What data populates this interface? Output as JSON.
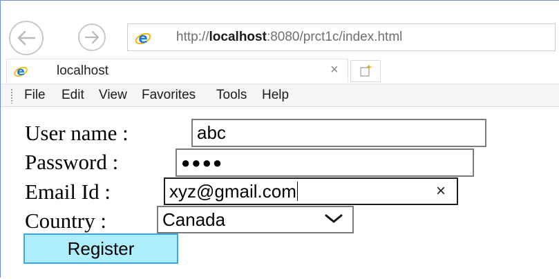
{
  "browser": {
    "url_prefix": "http://",
    "url_host": "localhost",
    "url_rest": ":8080/prct1c/index.html",
    "tab_title": "localhost",
    "tab_close": "×",
    "icons": {
      "back": "back-arrow-icon",
      "forward": "forward-arrow-icon",
      "page": "ie-logo-icon",
      "new_tab": "new-tab-icon"
    }
  },
  "menu": [
    "File",
    "Edit",
    "View",
    "Favorites",
    "Tools",
    "Help"
  ],
  "form": {
    "username_label": "User name :",
    "username_value": "abc",
    "password_label": "Password :",
    "password_mask": "●●●●",
    "email_label": "Email Id :",
    "email_value": "xyz@gmail.com",
    "email_clear": "×",
    "country_label": "Country :",
    "country_value": "Canada",
    "register_label": "Register"
  },
  "colors": {
    "register_bg": "#aeeefc",
    "register_border": "#3aa7d8",
    "frame_border": "#6d8fc7"
  }
}
